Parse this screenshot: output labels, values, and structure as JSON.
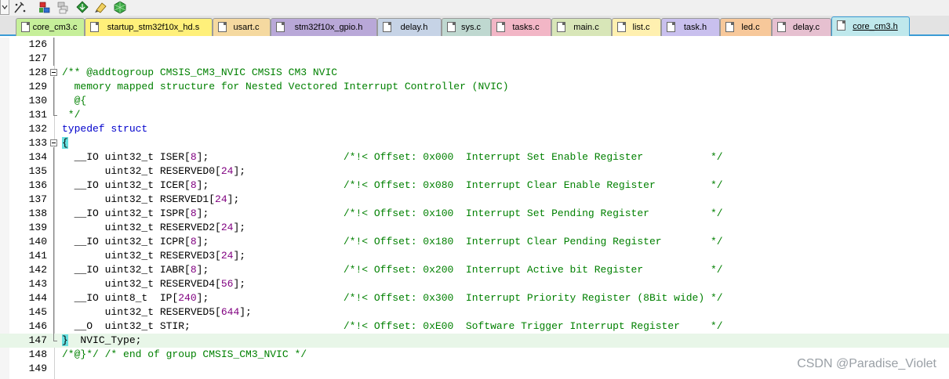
{
  "window": {
    "watermark": "CSDN @Paradise_Violet"
  },
  "toolbar": {
    "icons": [
      "dropdown-arrow-icon",
      "wizard-icon",
      "build-target-icon",
      "batch-build-icon",
      "download-icon",
      "debug-icon",
      "manage-components-icon"
    ]
  },
  "tabs": [
    {
      "label": "core_cm3.c",
      "color": "#c6ef9a"
    },
    {
      "label": "startup_stm32f10x_hd.s",
      "color": "#fff07a"
    },
    {
      "label": "usart.c",
      "color": "#f5d9a0"
    },
    {
      "label": "stm32f10x_gpio.h",
      "color": "#b9a8d8"
    },
    {
      "label": "delay.h",
      "color": "#c6d3e6"
    },
    {
      "label": "sys.c",
      "color": "#bfd8d0"
    },
    {
      "label": "tasks.c",
      "color": "#f2b6c6"
    },
    {
      "label": "main.c",
      "color": "#d8e6b8"
    },
    {
      "label": "list.c",
      "color": "#fff0b0"
    },
    {
      "label": "task.h",
      "color": "#c9c0ee"
    },
    {
      "label": "led.c",
      "color": "#f7c89a"
    },
    {
      "label": "delay.c",
      "color": "#e6c0d0"
    },
    {
      "label": "core_cm3.h",
      "color": "#bfe8ec",
      "active": true
    }
  ],
  "editor": {
    "current_line": "147",
    "lines": [
      {
        "n": "126",
        "code": ""
      },
      {
        "n": "127",
        "code": ""
      },
      {
        "n": "128",
        "code": "/** @addtogroup CMSIS_CM3_NVIC CMSIS CM3 NVIC"
      },
      {
        "n": "129",
        "code": "  memory mapped structure for Nested Vectored Interrupt Controller (NVIC)"
      },
      {
        "n": "130",
        "code": "  @{"
      },
      {
        "n": "131",
        "code": " */"
      },
      {
        "n": "132",
        "code": "typedef struct"
      },
      {
        "n": "133",
        "code": "{"
      },
      {
        "n": "134",
        "code": "  __IO uint32_t ISER[8];                      /*!< Offset: 0x000  Interrupt Set Enable Register           */"
      },
      {
        "n": "135",
        "code": "       uint32_t RESERVED0[24];"
      },
      {
        "n": "136",
        "code": "  __IO uint32_t ICER[8];                      /*!< Offset: 0x080  Interrupt Clear Enable Register         */"
      },
      {
        "n": "137",
        "code": "       uint32_t RSERVED1[24];"
      },
      {
        "n": "138",
        "code": "  __IO uint32_t ISPR[8];                      /*!< Offset: 0x100  Interrupt Set Pending Register          */"
      },
      {
        "n": "139",
        "code": "       uint32_t RESERVED2[24];"
      },
      {
        "n": "140",
        "code": "  __IO uint32_t ICPR[8];                      /*!< Offset: 0x180  Interrupt Clear Pending Register        */"
      },
      {
        "n": "141",
        "code": "       uint32_t RESERVED3[24];"
      },
      {
        "n": "142",
        "code": "  __IO uint32_t IABR[8];                      /*!< Offset: 0x200  Interrupt Active bit Register           */"
      },
      {
        "n": "143",
        "code": "       uint32_t RESERVED4[56];"
      },
      {
        "n": "144",
        "code": "  __IO uint8_t  IP[240];                      /*!< Offset: 0x300  Interrupt Priority Register (8Bit wide) */"
      },
      {
        "n": "145",
        "code": "       uint32_t RESERVED5[644];"
      },
      {
        "n": "146",
        "code": "  __O  uint32_t STIR;                         /*!< Offset: 0xE00  Software Trigger Interrupt Register     */"
      },
      {
        "n": "147",
        "code": "}  NVIC_Type;"
      },
      {
        "n": "148",
        "code": "/*@}*/ /* end of group CMSIS_CM3_NVIC */"
      },
      {
        "n": "149",
        "code": ""
      }
    ]
  }
}
